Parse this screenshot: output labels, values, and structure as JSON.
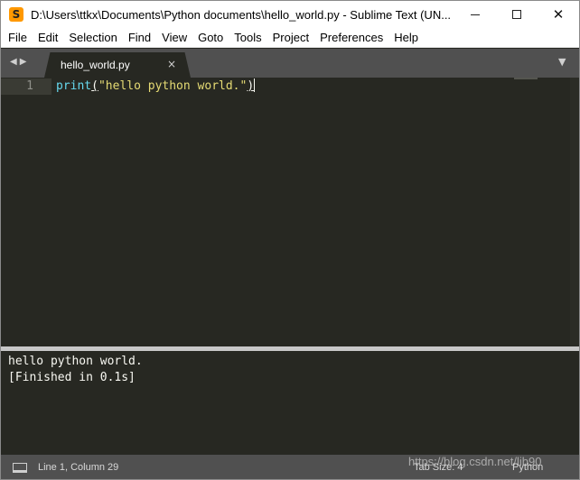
{
  "window": {
    "title": "D:\\Users\\ttkx\\Documents\\Python documents\\hello_world.py - Sublime Text (UN...",
    "app_icon": "sublime-text-icon",
    "controls": {
      "minimize": "minimize-icon",
      "maximize": "maximize-icon",
      "close": "✕"
    }
  },
  "menu": {
    "items": [
      "File",
      "Edit",
      "Selection",
      "Find",
      "View",
      "Goto",
      "Tools",
      "Project",
      "Preferences",
      "Help"
    ]
  },
  "tabs": {
    "nav_left": "◀",
    "nav_right": "▶",
    "dropdown": "▼",
    "items": [
      {
        "label": "hello_world.py",
        "close": "×",
        "active": true
      }
    ]
  },
  "editor": {
    "lines": [
      {
        "number": "1",
        "tokens": {
          "fn": "print",
          "paren_open": "(",
          "string": "\"hello python world.\"",
          "paren_close": ")"
        }
      }
    ]
  },
  "console": {
    "lines": [
      "hello python world.",
      "[Finished in 0.1s]"
    ]
  },
  "status": {
    "panel_icon": "panel-toggle-icon",
    "position": "Line 1, Column 29",
    "tab_size": "Tab Size: 4",
    "syntax": "Python"
  },
  "watermark": "https://blog.csdn.net/lib90",
  "colors": {
    "editor_bg": "#272822",
    "chrome_gray": "#505050",
    "function": "#66d9ef",
    "string": "#e6db74",
    "foreground": "#f8f8f2",
    "line_number": "#8f908a"
  }
}
